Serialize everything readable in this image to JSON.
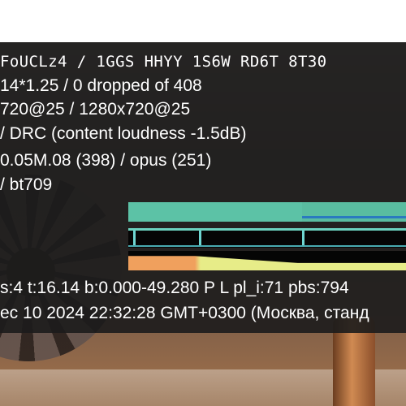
{
  "stats": {
    "codec_line": "FoUCLz4 / 1GGS HHYY 1S6W RD6T 8T30",
    "dropped_line": "14*1.25 / 0 dropped of 408",
    "resolution_line": "720@25 / 1280x720@25",
    "drc_line": "/ DRC (content loudness -1.5dB)",
    "format_line": "0.05M.08 (398) / opus (251)",
    "color_line": "/ bt709",
    "status_line": "s:4 t:16.14 b:0.000-49.280 P L pl_i:71 pbs:794",
    "date_line": "ec 10 2024 22:32:28 GMT+0300 (Москва, станд"
  },
  "colors": {
    "panel_background": "#1c1c1c",
    "text": "#ffffff",
    "bandwidth_graph": "#5dbea5",
    "buffer_line": "#6bd2bf",
    "quality_orange": "#f0a05d",
    "quality_yellow": "#e7ec88"
  },
  "graphs": {
    "bandwidth": "bandwidth-graph",
    "buffer": "buffer-health-graph",
    "quality": "quality-graph"
  },
  "background": {
    "fan": "fan-icon",
    "pipe": "copper-pipe"
  }
}
